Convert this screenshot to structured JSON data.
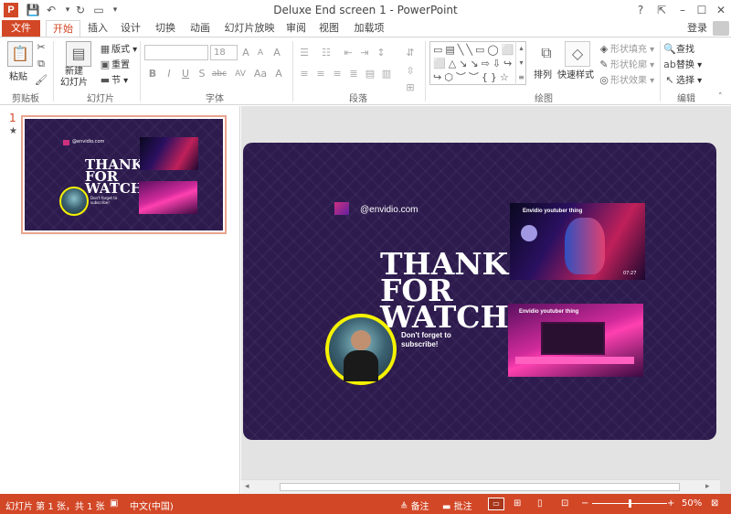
{
  "app": {
    "title": "Deluxe End screen 1 - PowerPoint",
    "icon_letter": "P",
    "login": "登录"
  },
  "quick_access": [
    "save-icon",
    "undo-icon",
    "redo-icon",
    "start-slideshow-icon",
    "customize-icon"
  ],
  "tabs": [
    {
      "label": "文件",
      "name": "tab-file"
    },
    {
      "label": "开始",
      "name": "tab-home",
      "active": true
    },
    {
      "label": "插入",
      "name": "tab-insert"
    },
    {
      "label": "设计",
      "name": "tab-design"
    },
    {
      "label": "切换",
      "name": "tab-transitions"
    },
    {
      "label": "动画",
      "name": "tab-animations"
    },
    {
      "label": "幻灯片放映",
      "name": "tab-slideshow"
    },
    {
      "label": "审阅",
      "name": "tab-review"
    },
    {
      "label": "视图",
      "name": "tab-view"
    },
    {
      "label": "加载项",
      "name": "tab-addins"
    }
  ],
  "ribbon": {
    "clipboard": {
      "label": "剪贴板",
      "paste": "粘贴"
    },
    "slides": {
      "label": "幻灯片",
      "new_slide": "新建\n幻灯片",
      "layout": "版式",
      "reset": "重置",
      "section": "节"
    },
    "font": {
      "label": "字体",
      "font_size": "18",
      "bold": "B",
      "italic": "I",
      "underline": "U",
      "shadow": "S",
      "strike": "abc",
      "spacing": "AV",
      "grow": "A",
      "shrink": "A",
      "case": "Aa",
      "clear": "A",
      "color": "A"
    },
    "paragraph": {
      "label": "段落"
    },
    "drawing": {
      "label": "绘图",
      "arrange": "排列",
      "quick_styles": "快速样式",
      "fill": "形状填充",
      "outline": "形状轮廓",
      "effects": "形状效果"
    },
    "editing": {
      "label": "编辑",
      "find": "查找",
      "replace": "替换",
      "select": "选择"
    }
  },
  "thumbnails": [
    {
      "number": "1",
      "marker": "★"
    }
  ],
  "slide": {
    "handle": "@envidio.com",
    "thanks_lines": [
      "THANKS",
      "FOR",
      "WATCHI"
    ],
    "subscribe": "Don't forget to\nsubscribe!",
    "video1_title": "Envidio youtuber thing",
    "video1_time": "07:27",
    "video2_title": "Envidio youtuber thing",
    "colors": {
      "background": "#2d1b4e",
      "ring": "#f5f200"
    }
  },
  "status": {
    "slide_info": "幻灯片 第 1 张，共 1 张",
    "language": "中文(中国)",
    "notes": "备注",
    "comments": "批注",
    "zoom": "50%",
    "zoom_fraction": 0.5,
    "accent": "#d24726"
  }
}
